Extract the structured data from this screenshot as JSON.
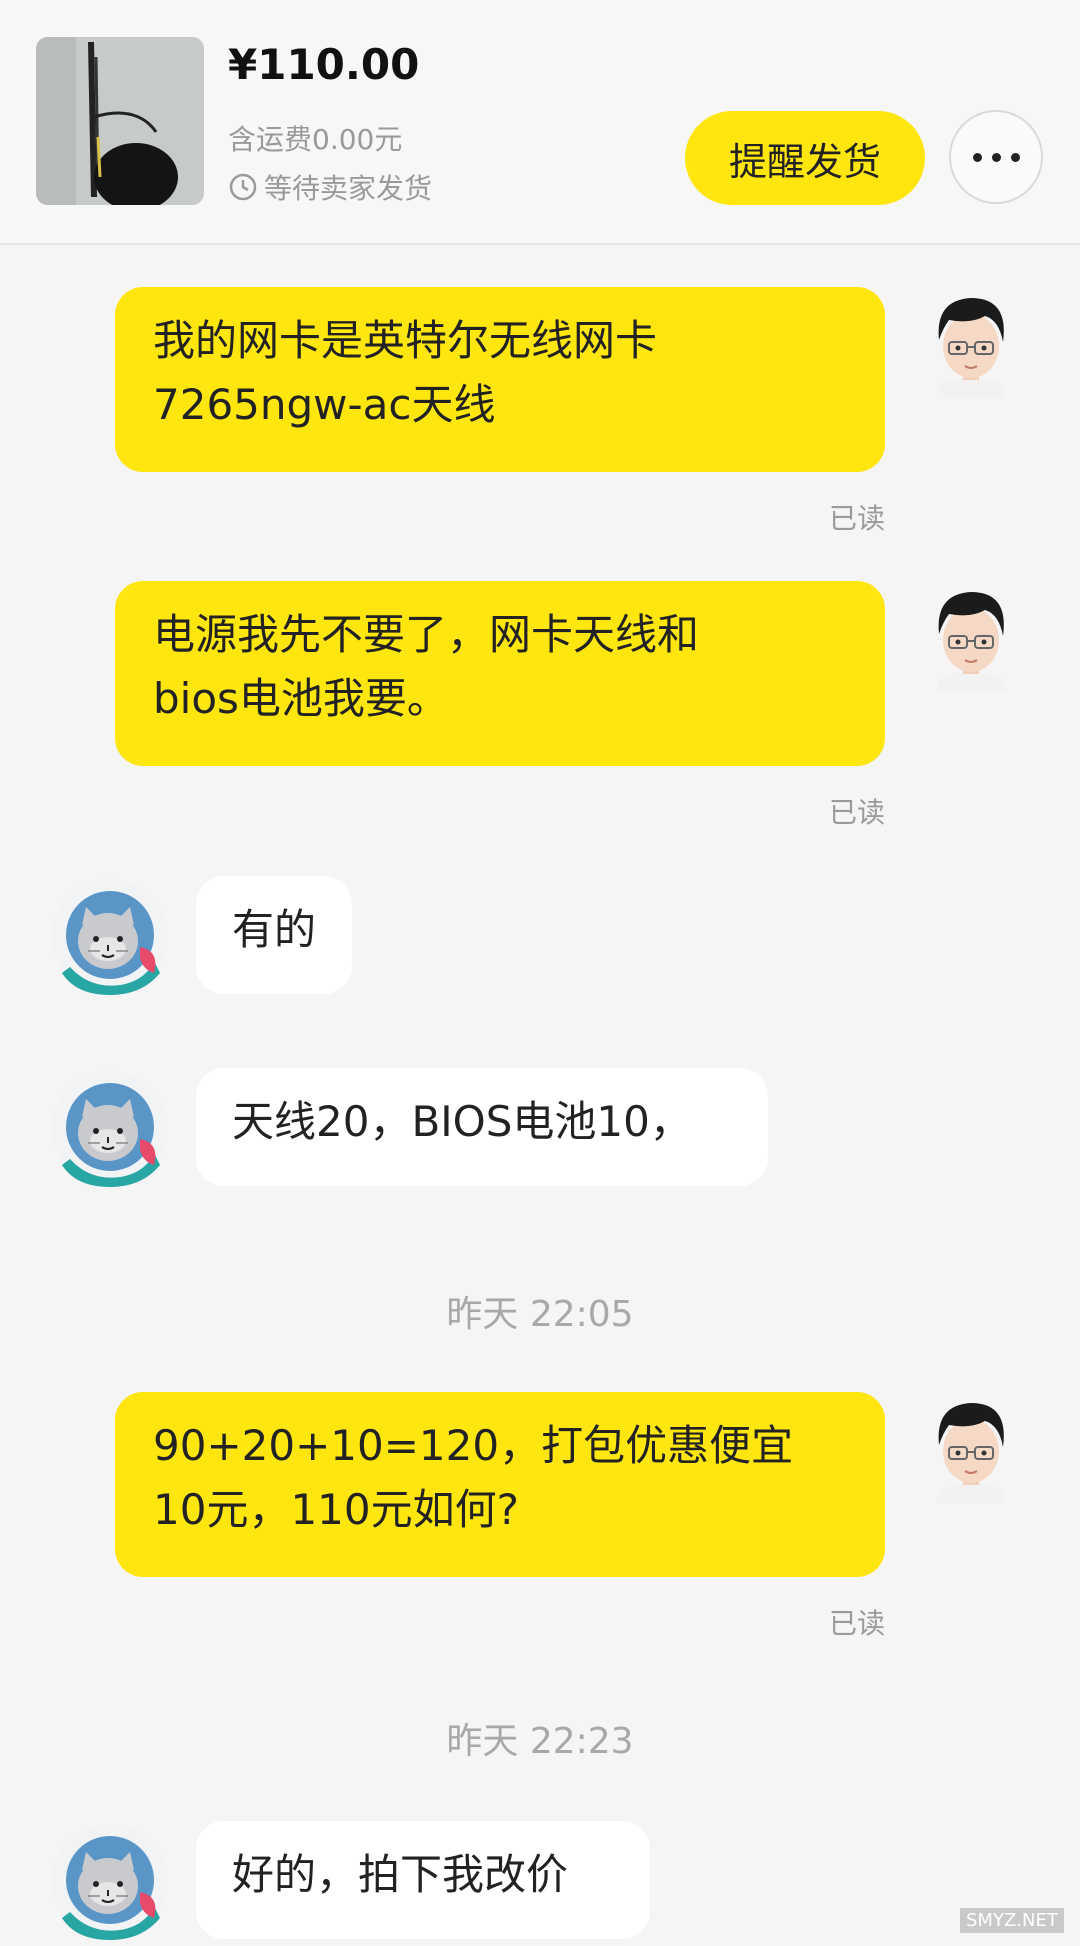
{
  "order": {
    "price": "¥110.00",
    "shipping": "含运费0.00元",
    "status": "等待卖家发货",
    "remind_label": "提醒发货"
  },
  "messages": [
    {
      "side": "out",
      "text": "我的网卡是英特尔无线网卡\n7265ngw-ac天线",
      "read": "已读"
    },
    {
      "side": "out",
      "text": "电源我先不要了，网卡天线和\nbios电池我要。",
      "read": "已读"
    },
    {
      "side": "in",
      "text": "有的"
    },
    {
      "side": "in",
      "text": "天线20，BIOS电池10，"
    },
    {
      "side": "out",
      "text": "90+20+10=120，打包优惠便宜\n10元，110元如何?",
      "read": "已读"
    },
    {
      "side": "in",
      "text": "好的，拍下我改价"
    }
  ],
  "time_separators": [
    "昨天 22:05",
    "昨天 22:23"
  ],
  "watermark": "SMYZ.NET",
  "colors": {
    "accent": "#ffe60f",
    "background": "#f5f5f5"
  }
}
